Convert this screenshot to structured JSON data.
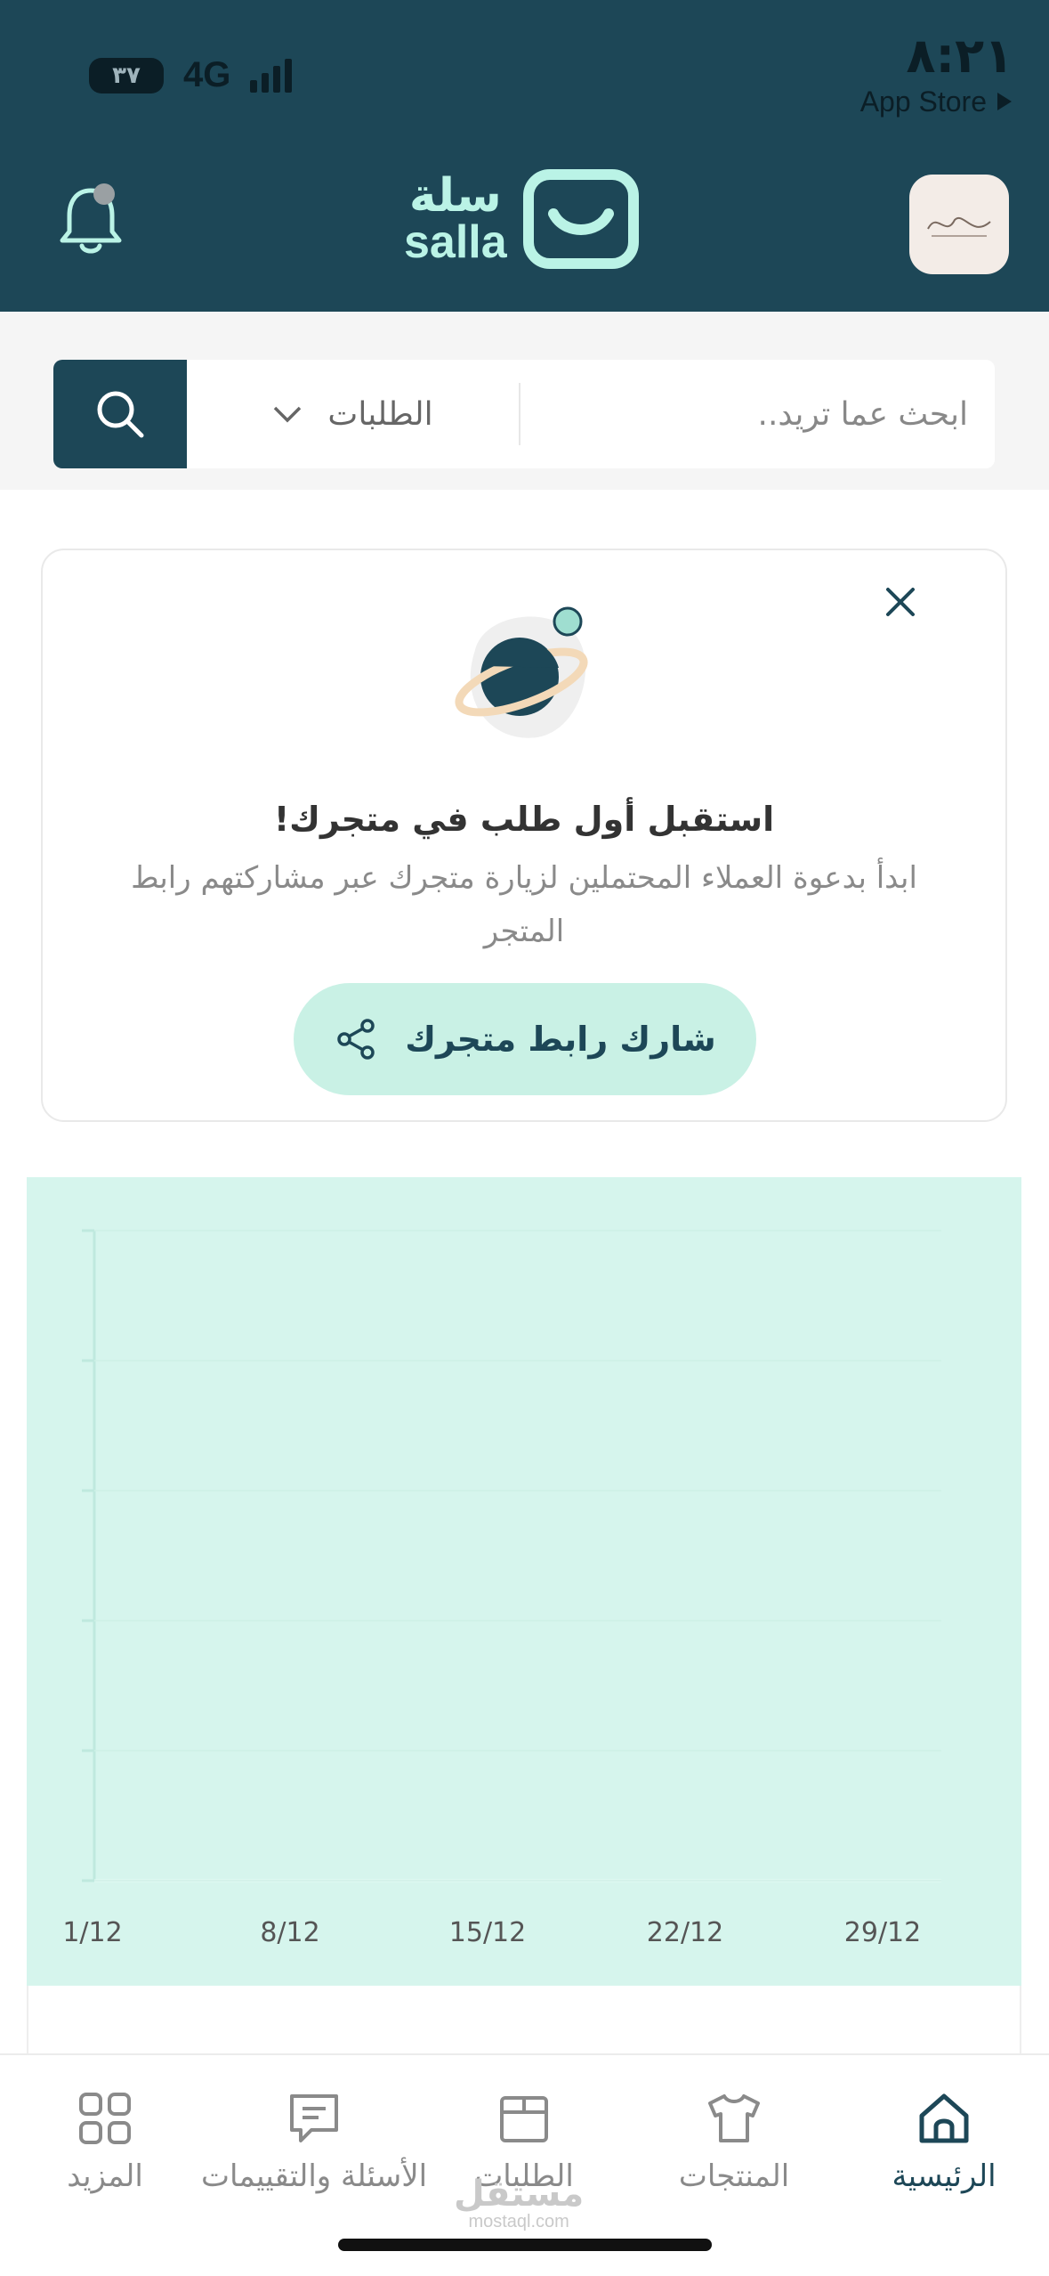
{
  "status_bar": {
    "battery": "٣٧",
    "network": "4G",
    "time": "٨:٢١",
    "back_app": "App Store",
    "back_icon": "play-arrow-icon"
  },
  "header": {
    "logo_ar": "سلة",
    "logo_en": "salla",
    "notification_icon": "bell-icon",
    "store_avatar_icon": "store-logo",
    "colors": {
      "background": "#1d4757",
      "logo": "#baf3e6"
    }
  },
  "search": {
    "placeholder": "ابحث عما تريد..",
    "filter_label": "الطلبات",
    "button_icon": "search-icon"
  },
  "onboarding_card": {
    "title": "استقبل أول طلب في متجرك!",
    "description": "ابدأ بدعوة العملاء المحتملين لزيارة متجرك عبر مشاركتهم رابط المتجر",
    "button_label": "شارك رابط متجرك",
    "close_icon": "close-icon",
    "illustration_icon": "planet-icon"
  },
  "chart_data": {
    "type": "line",
    "categories": [
      "1/12",
      "8/12",
      "15/12",
      "22/12",
      "29/12"
    ],
    "series": [],
    "background": "#d6f5ed"
  },
  "tabbar": {
    "tabs": [
      {
        "label": "الرئيسية",
        "icon": "home-icon",
        "active": true
      },
      {
        "label": "المنتجات",
        "icon": "shirt-icon",
        "active": false
      },
      {
        "label": "الطلبات",
        "icon": "box-icon",
        "active": false
      },
      {
        "label": "الأسئلة والتقييمات",
        "icon": "chat-icon",
        "active": false
      },
      {
        "label": "المزيد",
        "icon": "grid-icon",
        "active": false
      }
    ]
  },
  "watermark": {
    "ar": "مستقل",
    "en": "mostaql.com"
  }
}
